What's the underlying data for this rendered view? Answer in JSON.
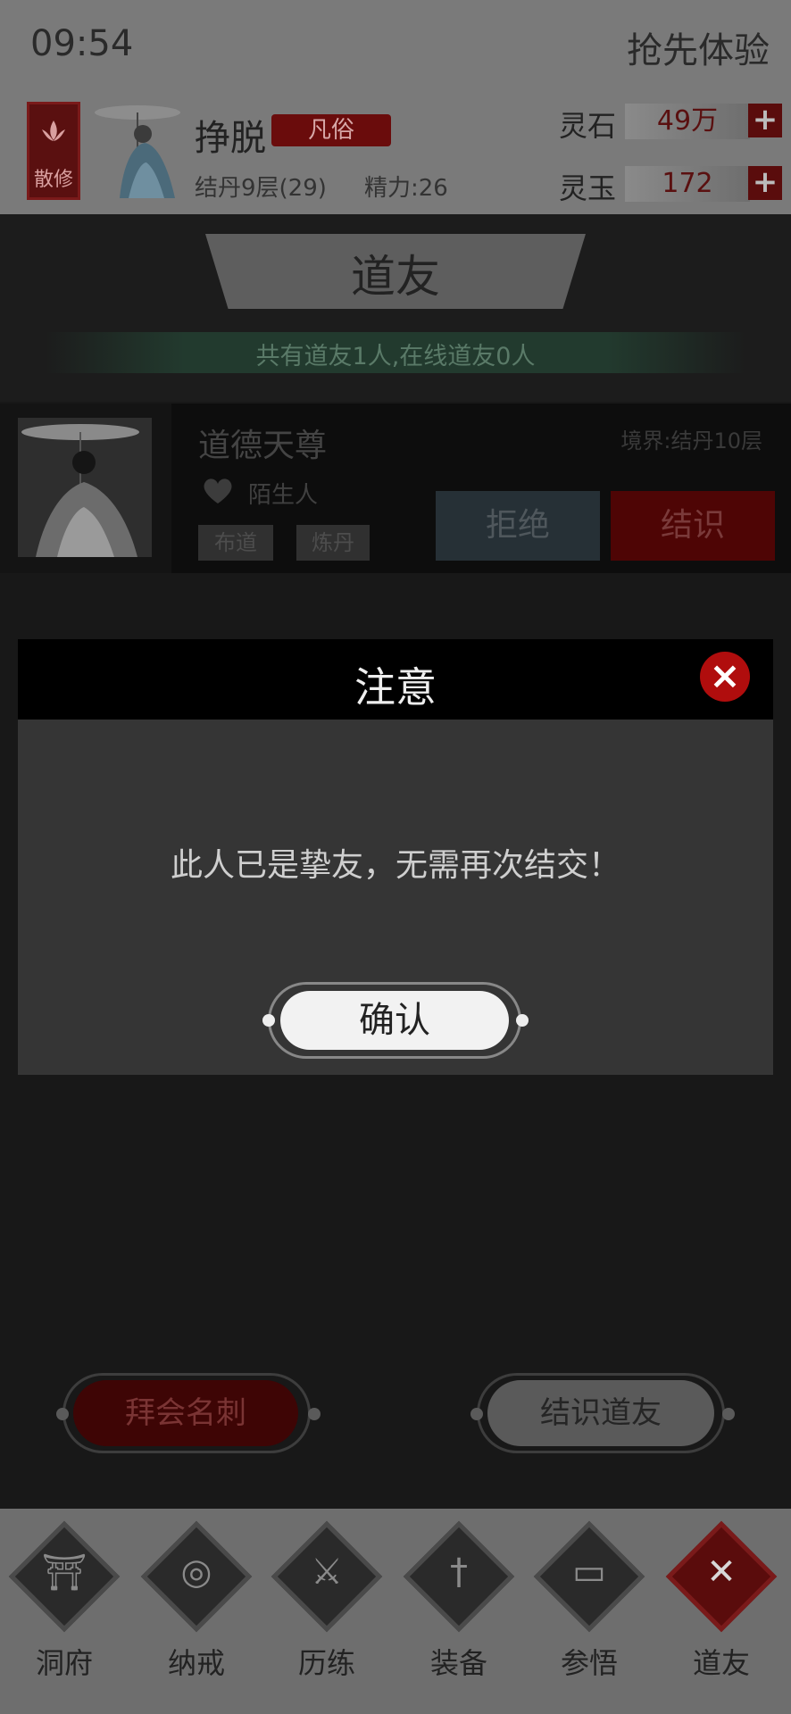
{
  "status": {
    "time": "09:54",
    "trial_label": "抢先体验"
  },
  "player": {
    "sect": "散修",
    "name": "挣脱",
    "rank": "凡俗",
    "cultivation": "结丹9层(29)",
    "energy": "精力:26"
  },
  "resources": [
    {
      "label": "灵石",
      "value": "49万"
    },
    {
      "label": "灵玉",
      "value": "172"
    }
  ],
  "page": {
    "title": "道友",
    "summary": "共有道友1人,在线道友0人"
  },
  "friend": {
    "name": "道德天尊",
    "realm": "境界:结丹10层",
    "relation": "陌生人",
    "tags": [
      "布道",
      "炼丹"
    ],
    "reject_label": "拒绝",
    "befriend_label": "结识"
  },
  "modal": {
    "title": "注意",
    "message": "此人已是挚友，无需再次结交！",
    "confirm_label": "确认"
  },
  "actions": {
    "visit_label": "拜会名刺",
    "meet_label": "结识道友"
  },
  "tabs": [
    {
      "label": "洞府",
      "icon": "gate-icon"
    },
    {
      "label": "纳戒",
      "icon": "ring-icon"
    },
    {
      "label": "历练",
      "icon": "crossed-swords-icon"
    },
    {
      "label": "装备",
      "icon": "dagger-icon"
    },
    {
      "label": "参悟",
      "icon": "book-icon"
    },
    {
      "label": "道友",
      "icon": "close-x-icon",
      "active": true
    }
  ],
  "colors": {
    "accent_red": "#b00d0d",
    "dark_red": "#5a0c0c",
    "overlay_gray": "#7a7a7a"
  }
}
